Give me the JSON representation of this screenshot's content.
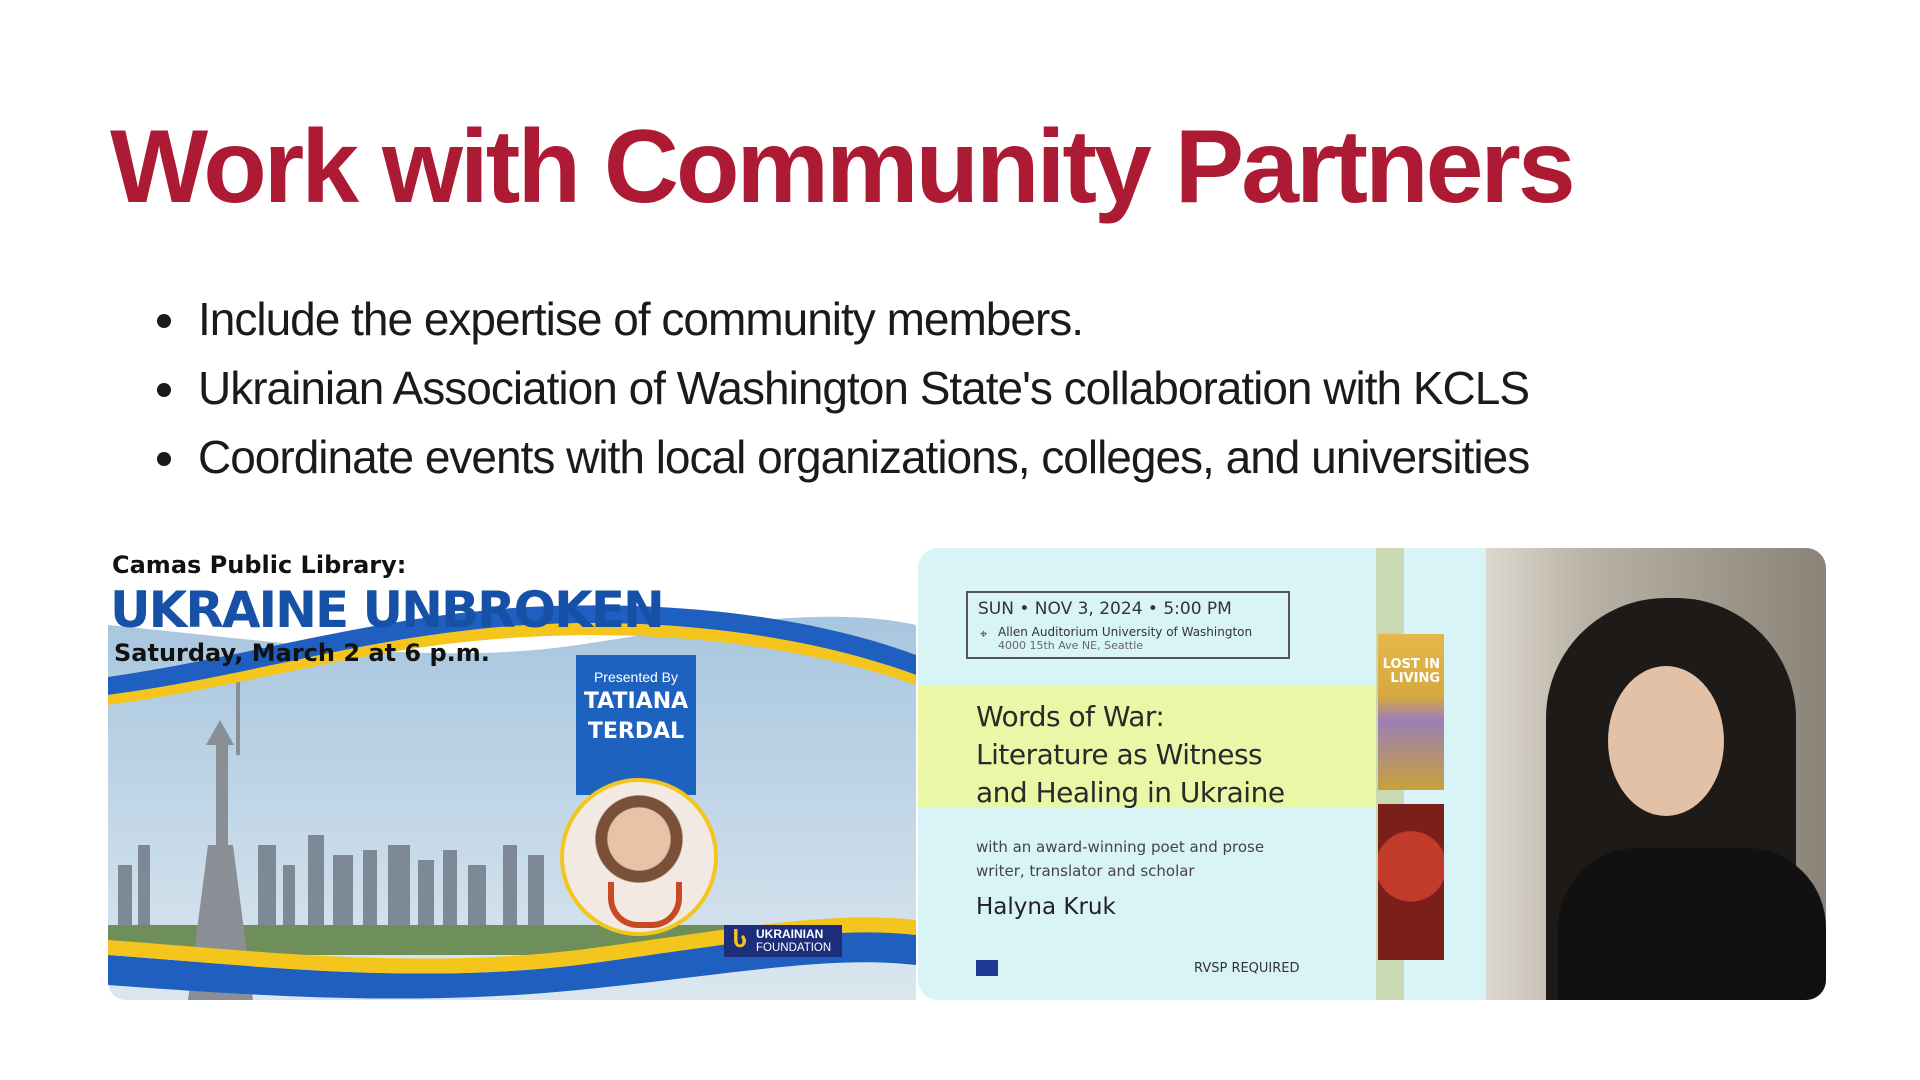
{
  "slide": {
    "title": "Work with Community Partners",
    "title_color": "#ad1a33",
    "bullets": [
      "Include the expertise of community members.",
      "Ukrainian Association of Washington State's collaboration with KCLS",
      "Coordinate events with local organizations, colleges, and universities"
    ]
  },
  "poster1": {
    "header_line1": "Camas Public Library:",
    "header_title": "UKRAINE UNBROKEN",
    "header_date": "Saturday, March 2 at 6 p.m.",
    "presented_by": "Presented By",
    "presenter_first": "TATIANA",
    "presenter_last": "TERDAL",
    "logo_line1": "UKRAINIAN",
    "logo_line2": "FOUNDATION",
    "colors": {
      "blue": "#1651a7",
      "yellow": "#f4c51d"
    }
  },
  "poster2": {
    "date_line": "SUN • NOV 3, 2024 • 5:00 PM",
    "venue": "Allen Auditorium University of Washington",
    "address": "4000 15th Ave NE, Seattle",
    "title_lines": [
      "Words of War:",
      "Literature as Witness",
      "and Healing in Ukraine"
    ],
    "subtitle_lines": [
      "with an award-winning poet and prose",
      "writer, translator and scholar"
    ],
    "speaker": "Halyna Kruk",
    "rsvp": "RVSP REQUIRED",
    "book_title_lines": [
      "LOST IN",
      "LIVING"
    ],
    "colors": {
      "background": "#d9f4f7",
      "title_band": "#eaf7a6"
    }
  }
}
